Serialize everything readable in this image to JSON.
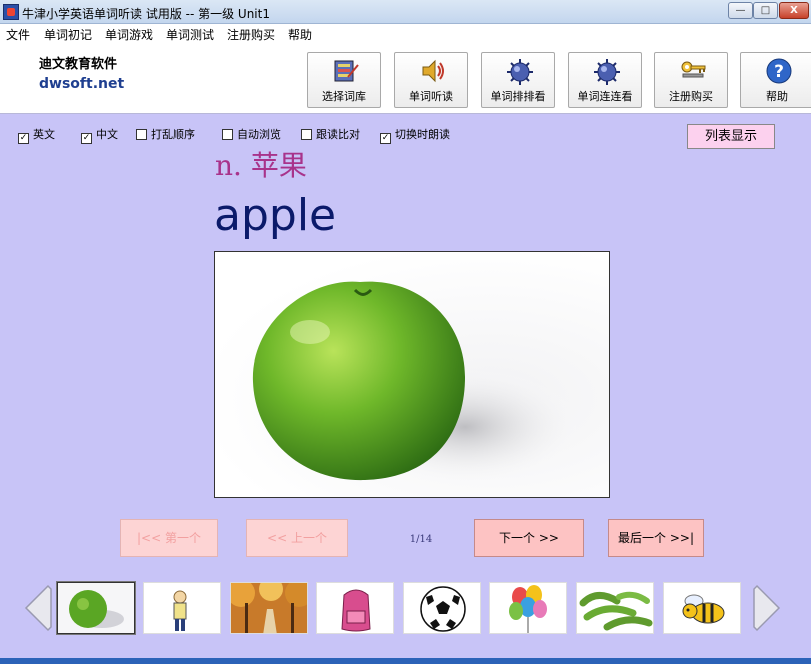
{
  "window": {
    "title": "牛津小学英语单词听读 试用版 -- 第一级  Unit1",
    "min_symbol": "—",
    "max_symbol": "□",
    "close_symbol": "X"
  },
  "menu": [
    "文件",
    "单词初记",
    "单词游戏",
    "单词测试",
    "注册购买",
    "帮助"
  ],
  "header": {
    "company": "迪文教育软件",
    "site": "dwsoft.net"
  },
  "toolbar": [
    {
      "label": "选择词库",
      "icon": "book-select-icon"
    },
    {
      "label": "单词听读",
      "icon": "speaker-icon"
    },
    {
      "label": "单词排排看",
      "icon": "gear-ball-icon"
    },
    {
      "label": "单词连连看",
      "icon": "gear-ball-icon"
    },
    {
      "label": "注册购买",
      "icon": "key-icon"
    },
    {
      "label": "帮助",
      "icon": "help-icon"
    }
  ],
  "options": [
    {
      "label": "英文",
      "checked": true
    },
    {
      "label": "中文",
      "checked": true
    },
    {
      "label": "打乱顺序",
      "checked": false
    },
    {
      "label": "自动浏览",
      "checked": false
    },
    {
      "label": "跟读比对",
      "checked": false
    },
    {
      "label": "切换时朗读",
      "checked": true
    }
  ],
  "list_button": "列表显示",
  "card": {
    "part_of_speech_cn": "n. 苹果",
    "word": "apple"
  },
  "nav": {
    "first": "|<< 第一个",
    "prev": "<< 上一个",
    "page": "1/14",
    "next": "下一个 >>",
    "last": "最后一个 >>|"
  },
  "thumbnails": [
    {
      "name": "apple-thumb"
    },
    {
      "name": "boy-thumb"
    },
    {
      "name": "autumn-road-thumb"
    },
    {
      "name": "schoolbag-thumb"
    },
    {
      "name": "football-thumb"
    },
    {
      "name": "balloons-thumb"
    },
    {
      "name": "beans-thumb"
    },
    {
      "name": "bee-thumb"
    }
  ],
  "colors": {
    "main_bg": "#c8c4f7",
    "word_color": "#0b1a6a",
    "cn_color": "#a8338b",
    "button_pink": "#fdc3c3"
  }
}
